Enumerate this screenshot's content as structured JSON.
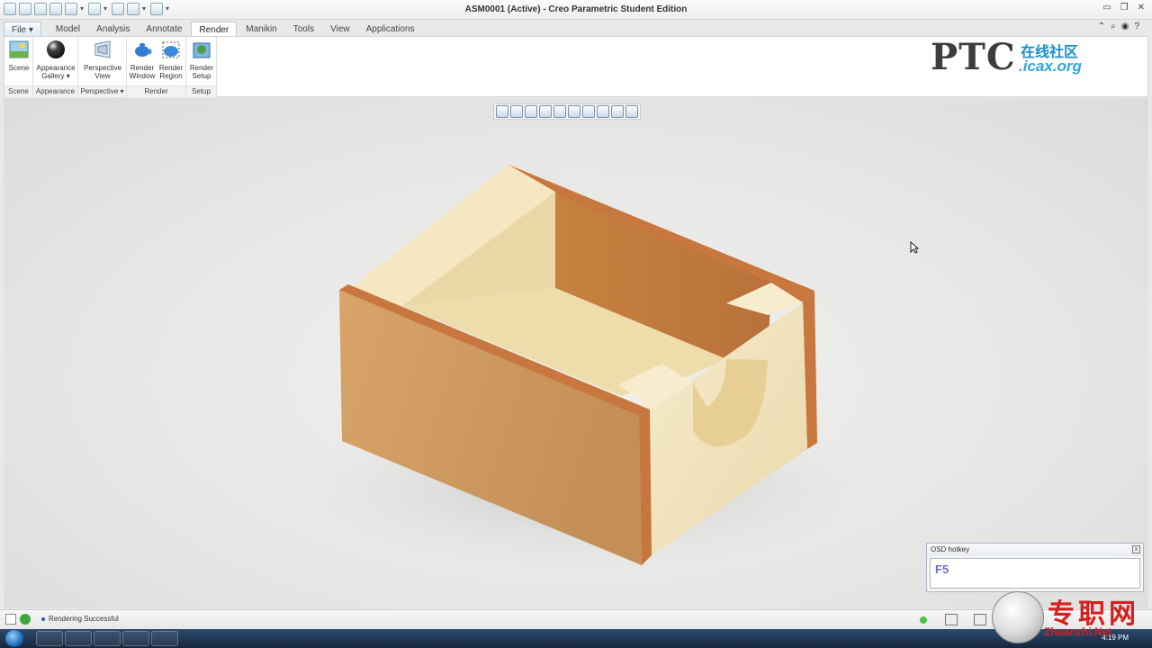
{
  "window": {
    "title": "ASM0001 (Active) - Creo Parametric Student Edition"
  },
  "tabs": [
    {
      "label": "File ▾"
    },
    {
      "label": "Model"
    },
    {
      "label": "Analysis"
    },
    {
      "label": "Annotate"
    },
    {
      "label": "Render"
    },
    {
      "label": "Manikin"
    },
    {
      "label": "Tools"
    },
    {
      "label": "View"
    },
    {
      "label": "Applications"
    }
  ],
  "active_tab": "Render",
  "ribbon": {
    "groups": [
      {
        "label": "Scene"
      },
      {
        "label": "Appearance"
      },
      {
        "label": "Perspective ▾"
      },
      {
        "label": "Render"
      },
      {
        "label": "Setup"
      }
    ],
    "buttons": {
      "scene": "Scene",
      "appearance_gallery_1": "Appearance",
      "appearance_gallery_2": "Gallery ▾",
      "perspective_1": "Perspective",
      "perspective_2": "View",
      "render_window_1": "Render",
      "render_window_2": "Window",
      "render_region_1": "Render",
      "render_region_2": "Region",
      "render_setup_1": "Render",
      "render_setup_2": "Setup"
    }
  },
  "logo": {
    "brand": "PTC",
    "cn": "在线社区",
    "domain": ".icax.org"
  },
  "osd": {
    "title": "OSD hotkey",
    "key": "F5"
  },
  "status": {
    "message": "Rendering Successful"
  },
  "taskbar": {
    "clock": "4:19 PM"
  },
  "watermark": {
    "cn": "专职网",
    "en": "Zhuanzhi.Net"
  },
  "colors": {
    "wood_light": "#f2e4bf",
    "wood_dark": "#c9955c",
    "edge": "#c8773e"
  }
}
